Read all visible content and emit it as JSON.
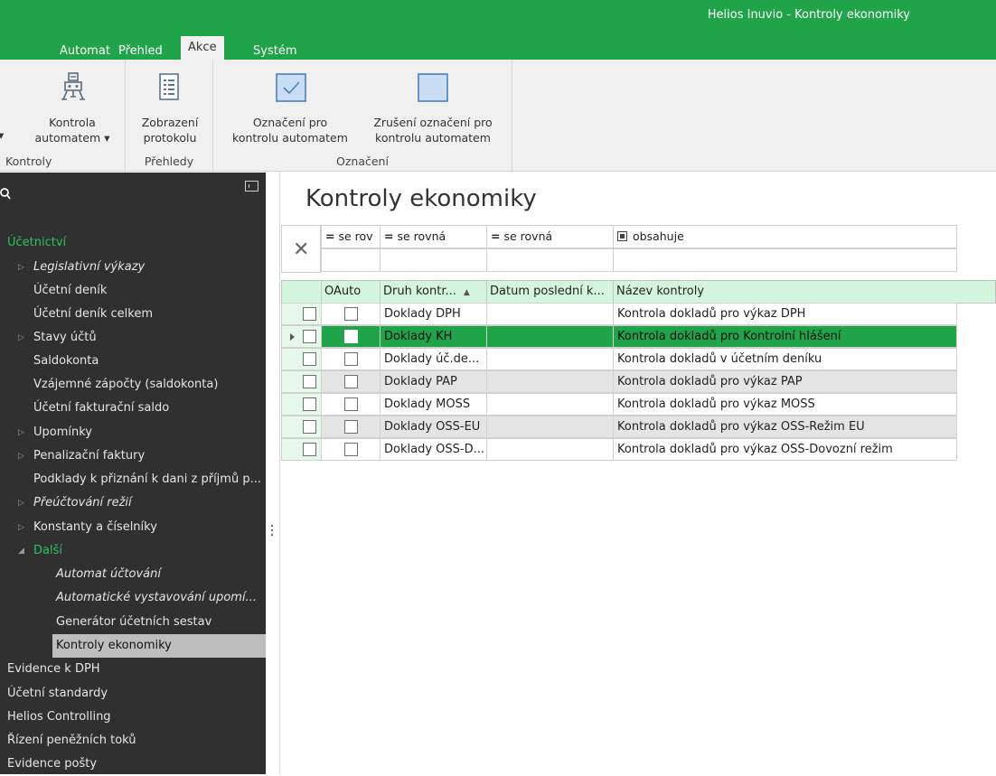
{
  "window": {
    "title": "Helios Inuvio - Kontroly ekonomiky"
  },
  "tabs": [
    {
      "label": "Automat"
    },
    {
      "label": "Přehled"
    },
    {
      "label": "Akce",
      "active": true
    },
    {
      "label": "Systém"
    }
  ],
  "ribbon": {
    "groups": [
      {
        "label": "Kontroly",
        "buttons": [
          {
            "line1": "Kontrola",
            "line2": "automatem ▾",
            "icon": "robot-icon"
          }
        ]
      },
      {
        "label": "Přehledy",
        "buttons": [
          {
            "line1": "Zobrazení",
            "line2": "protokolu",
            "icon": "document-list-icon"
          }
        ]
      },
      {
        "label": "Označení",
        "buttons": [
          {
            "line1": "Označení pro",
            "line2": "kontrolu automatem",
            "icon": "checkbox-checked-icon"
          },
          {
            "line1": "Zrušení označení pro",
            "line2": "kontrolu automatem",
            "icon": "checkbox-empty-icon"
          }
        ]
      }
    ],
    "left_partial_arrow": "▾"
  },
  "sidebar": {
    "items": [
      {
        "label": "Účetnictví",
        "green": true
      },
      {
        "label": "Legislativní výkazy",
        "arrow": "▷",
        "italic": true
      },
      {
        "label": "Účetní deník"
      },
      {
        "label": "Účetní deník celkem"
      },
      {
        "label": "Stavy účtů",
        "arrow": "▷"
      },
      {
        "label": "Saldokonta"
      },
      {
        "label": "Vzájemné zápočty (saldokonta)"
      },
      {
        "label": "Účetní fakturační saldo"
      },
      {
        "label": "Upomínky",
        "arrow": "▷"
      },
      {
        "label": "Penalizační faktury",
        "arrow": "▷"
      },
      {
        "label": "Podklady k přiznání k dani z příjmů p..."
      },
      {
        "label": "Přeúčtování režií",
        "arrow": "▷",
        "italic": true
      },
      {
        "label": "Konstanty a číselníky",
        "arrow": "▷"
      },
      {
        "label": "Další",
        "arrow": "◢",
        "green": true
      },
      {
        "label": "Automat účtování",
        "italic": true
      },
      {
        "label": "Automatické vystavování upomí...",
        "italic": true
      },
      {
        "label": "Generátor účetních sestav"
      },
      {
        "label": "Kontroly ekonomiky",
        "selected": true
      },
      {
        "label": "Evidence k DPH"
      },
      {
        "label": "Účetní standardy"
      },
      {
        "label": "Helios Controlling"
      },
      {
        "label": "Řízení peněžních toků"
      },
      {
        "label": "Evidence pošty"
      }
    ]
  },
  "main": {
    "title": "Kontroly ekonomiky",
    "filters": [
      {
        "op": "=",
        "text": "se rov"
      },
      {
        "op": "=",
        "text": "se rovná"
      },
      {
        "op": "=",
        "text": "se rovná"
      },
      {
        "op": "contains",
        "text": "obsahuje"
      }
    ],
    "columns": [
      "",
      "OAuto",
      "Druh kontr...",
      "Datum poslední k...",
      "Název kontroly"
    ],
    "sort_indicator": "▲",
    "rows": [
      {
        "druh": "Doklady DPH",
        "datum": "",
        "nazev": "Kontrola dokladů pro výkaz DPH",
        "style": "normal"
      },
      {
        "druh": "Doklady KH",
        "datum": "",
        "nazev": "Kontrola dokladů pro Kontrolní hlášení",
        "style": "selected"
      },
      {
        "druh": "Doklady úč.de...",
        "datum": "",
        "nazev": "Kontrola dokladů v účetním deníku",
        "style": "normal"
      },
      {
        "druh": "Doklady PAP",
        "datum": "",
        "nazev": "Kontrola dokladů pro výkaz PAP",
        "style": "alt"
      },
      {
        "druh": "Doklady MOSS",
        "datum": "",
        "nazev": "Kontrola dokladů pro výkaz MOSS",
        "style": "normal"
      },
      {
        "druh": "Doklady OSS-EU",
        "datum": "",
        "nazev": "Kontrola dokladů pro výkaz OSS-Režim EU",
        "style": "alt"
      },
      {
        "druh": "Doklady OSS-D...",
        "datum": "",
        "nazev": "Kontrola dokladů pro výkaz OSS-Dovozní režim",
        "style": "normal"
      }
    ]
  },
  "colors": {
    "accent": "#21a34a",
    "sidebar_bg": "#303030",
    "header_bg": "#d4f5dd"
  }
}
